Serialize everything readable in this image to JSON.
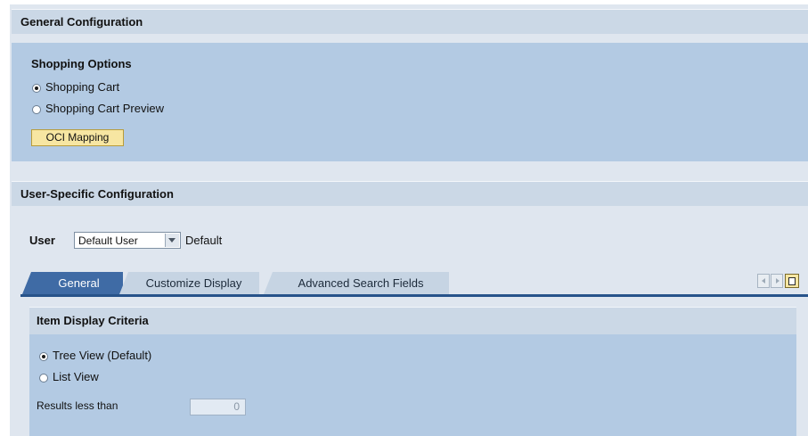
{
  "general_config": {
    "title": "General Configuration",
    "shopping_options": {
      "heading": "Shopping Options",
      "options": [
        {
          "label": "Shopping Cart",
          "selected": true
        },
        {
          "label": "Shopping Cart Preview",
          "selected": false
        }
      ],
      "oci_button": "OCI Mapping"
    }
  },
  "user_config": {
    "title": "User-Specific Configuration",
    "user_label": "User",
    "user_select_value": "Default User",
    "user_value_text": "Default",
    "tabs": [
      {
        "label": "General",
        "active": true
      },
      {
        "label": "Customize Display",
        "active": false
      },
      {
        "label": "Advanced Search Fields",
        "active": false
      }
    ],
    "nav_icons": [
      "scroll-left-icon",
      "scroll-right-icon",
      "tab-menu-icon"
    ]
  },
  "item_display": {
    "heading": "Item Display Criteria",
    "options": [
      {
        "label": "Tree View (Default)",
        "selected": true
      },
      {
        "label": "List View",
        "selected": false
      }
    ],
    "results_label": "Results less than",
    "results_value": "0"
  },
  "colors": {
    "header_bg": "#cbd8e6",
    "body_bg": "#b3cae3",
    "active_tab": "#3f6ba5",
    "button_yellow": "#f7e6a2"
  }
}
